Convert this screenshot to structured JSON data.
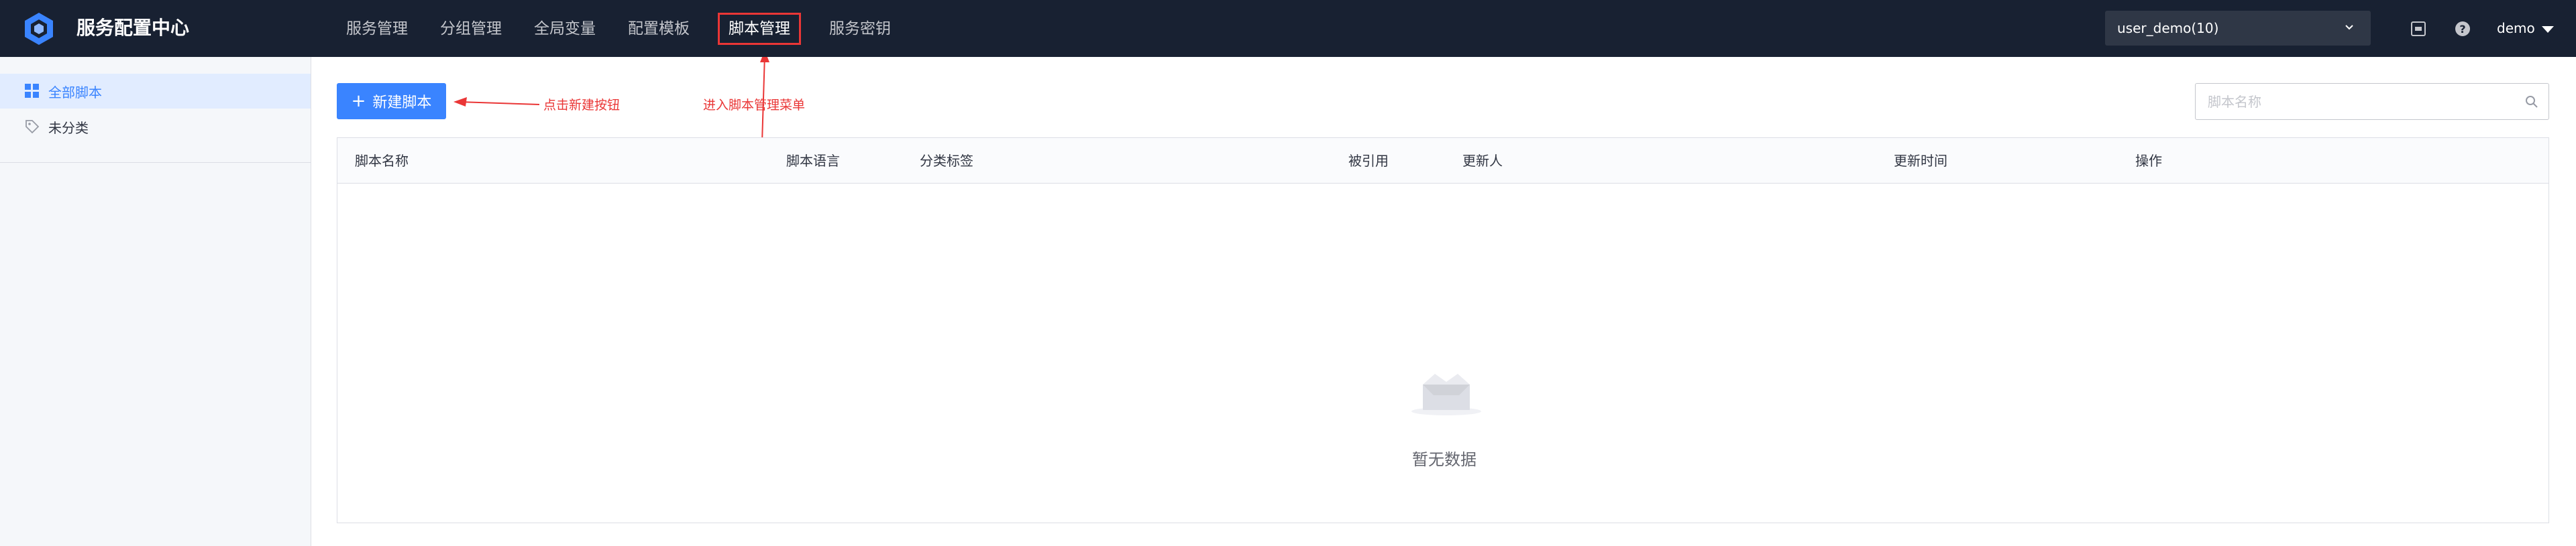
{
  "app": {
    "title": "服务配置中心",
    "logo_icon": "hexagon-logo-icon"
  },
  "nav": {
    "items": [
      {
        "label": "服务管理"
      },
      {
        "label": "分组管理"
      },
      {
        "label": "全局变量"
      },
      {
        "label": "配置模板"
      },
      {
        "label": "脚本管理",
        "active": true
      },
      {
        "label": "服务密钥"
      }
    ]
  },
  "header": {
    "business_selector": "user_demo(10)",
    "user_name": "demo",
    "icons": [
      "document-icon",
      "help-icon"
    ]
  },
  "sidebar": {
    "items": [
      {
        "label": "全部脚本",
        "icon": "grid-icon",
        "active": true
      },
      {
        "label": "未分类",
        "icon": "tag-icon"
      }
    ]
  },
  "main": {
    "new_button_label": "新建脚本",
    "search": {
      "placeholder": "脚本名称",
      "value": ""
    },
    "table": {
      "columns": [
        "脚本名称",
        "脚本语言",
        "分类标签",
        "被引用",
        "更新人",
        "更新时间",
        "操作"
      ],
      "rows": []
    },
    "empty_text": "暂无数据"
  },
  "annotations": {
    "new_button_hint": "点击新建按钮",
    "nav_hint": "进入脚本管理菜单"
  },
  "colors": {
    "topbar": "#182132",
    "accent": "#3a84ff",
    "annotation": "#ea3636",
    "sidebar_active_bg": "#e1ecff"
  }
}
